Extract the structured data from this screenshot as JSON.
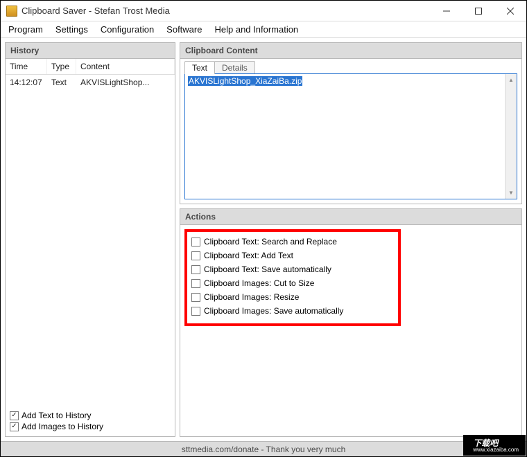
{
  "window": {
    "title": "Clipboard Saver - Stefan Trost Media"
  },
  "menu": {
    "program": "Program",
    "settings": "Settings",
    "configuration": "Configuration",
    "software": "Software",
    "help": "Help and Information"
  },
  "history": {
    "title": "History",
    "columns": {
      "time": "Time",
      "type": "Type",
      "content": "Content"
    },
    "rows": [
      {
        "time": "14:12:07",
        "type": "Text",
        "content": "AKVISLightShop..."
      }
    ],
    "add_text": "Add Text to History",
    "add_images": "Add Images to History"
  },
  "clipboard": {
    "title": "Clipboard Content",
    "tabs": {
      "text": "Text",
      "details": "Details"
    },
    "content": "AKVISLightShop_XiaZaiBa.zip"
  },
  "actions": {
    "title": "Actions",
    "items": [
      "Clipboard Text: Search and Replace",
      "Clipboard Text: Add Text",
      "Clipboard Text: Save automatically",
      "Clipboard Images: Cut to Size",
      "Clipboard Images: Resize",
      "Clipboard Images: Save automatically"
    ]
  },
  "statusbar": "sttmedia.com/donate - Thank you very much",
  "watermark": {
    "main": "下载吧",
    "sub": "www.xiazaiba.com"
  }
}
